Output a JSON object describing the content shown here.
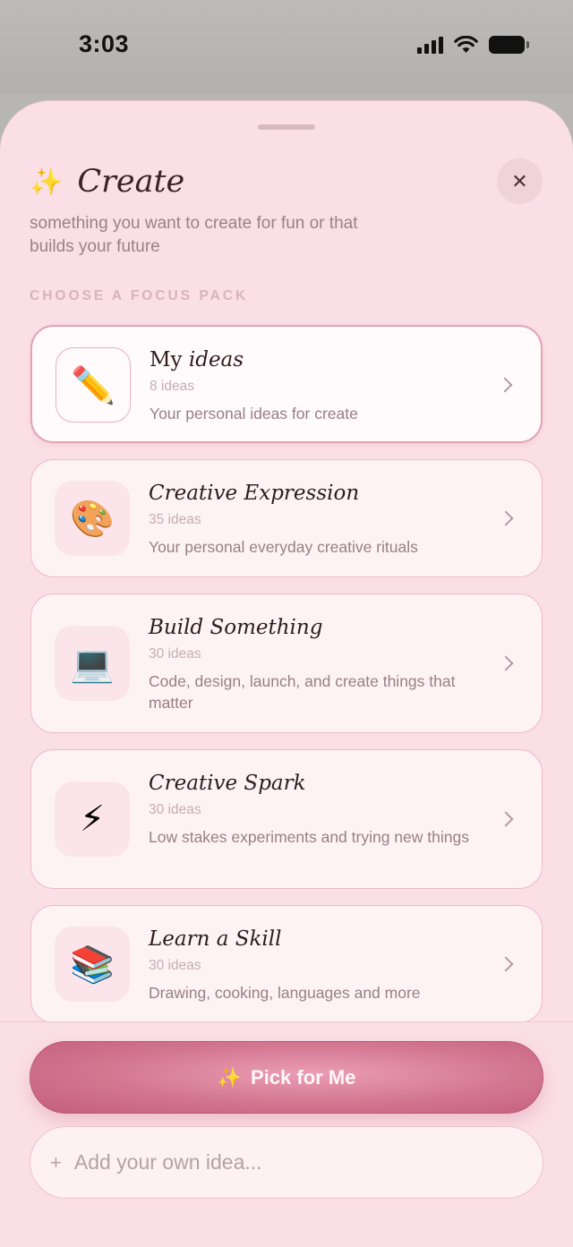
{
  "status_bar": {
    "time": "3:03"
  },
  "sheet": {
    "title_icon": "✨",
    "title": "Create",
    "subtitle": "something you want to create for fun or that builds your future",
    "section_label": "CHOOSE A FOCUS PACK",
    "close_label": "✕"
  },
  "packs": [
    {
      "emoji": "✏️",
      "title_plain": "My ",
      "title_italic": "ideas",
      "count": "8 ideas",
      "description": "Your personal ideas for create",
      "selected": true
    },
    {
      "emoji": "🎨",
      "title": "Creative Expression",
      "count": "35 ideas",
      "description": "Your personal everyday creative rituals"
    },
    {
      "emoji": "💻",
      "title": "Build Something",
      "count": "30 ideas",
      "description": "Code, design, launch, and create things that matter"
    },
    {
      "emoji": "⚡",
      "title": "Creative Spark",
      "count": "30 ideas",
      "description": "Low stakes experiments and trying new things"
    },
    {
      "emoji": "📚",
      "title": "Learn a Skill",
      "count": "30 ideas",
      "description": "Drawing, cooking, languages and more"
    }
  ],
  "footer": {
    "pick_icon": "✨",
    "pick_label": "Pick for Me",
    "add_plus": "+",
    "add_placeholder": "Add your own idea..."
  },
  "colors": {
    "accent": "#d2758f",
    "sheet_bg": "#fbdfe6",
    "card_border": "#ecb9c6"
  }
}
